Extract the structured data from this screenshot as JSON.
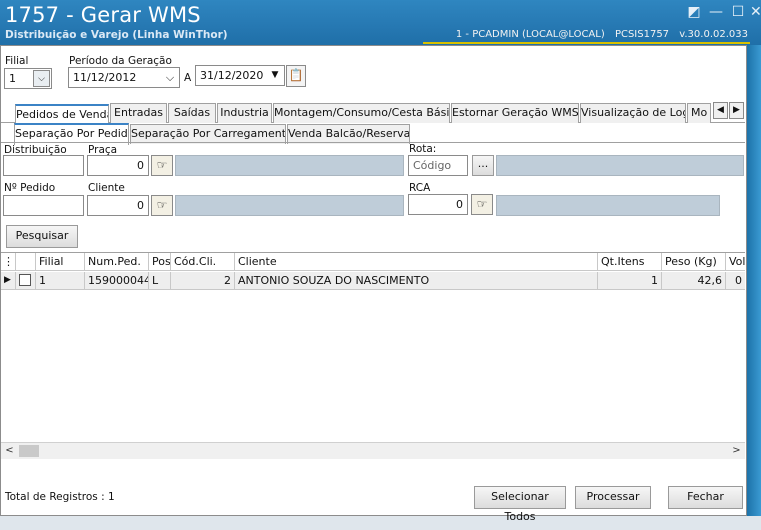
{
  "window": {
    "title": "1757 - Gerar WMS",
    "subtitle": "Distribuição e Varejo (Linha WinThor)",
    "status": [
      "1 - PCADMIN (LOCAL@LOCAL)",
      "PCSIS1757",
      "v.30.0.02.033"
    ],
    "controls": {
      "restore": "◩",
      "minimize": "—",
      "maximize": "☐",
      "close": "✕"
    }
  },
  "filters": {
    "filial_label": "Filial",
    "filial_value": "1",
    "periodo_label": "Período da Geração",
    "date_from": "11/12/2012",
    "to_label": "A",
    "date_to": "31/12/2020"
  },
  "tabs": [
    "Pedidos de Venda",
    "Entradas",
    "Saídas",
    "Industria",
    "Montagem/Consumo/Cesta Básica",
    "Estornar Geração WMS",
    "Visualização de Log",
    "Mo"
  ],
  "subtabs": [
    "Separação Por Pedido",
    "Separação Por Carregamento",
    "Venda Balcão/Reserva"
  ],
  "form": {
    "distribuicao_label": "Distribuição",
    "praca_label": "Praça",
    "praca_value": "0",
    "rota_label": "Rota:",
    "rota_placeholder": "Código",
    "rota_button": "...",
    "pedido_label": "Nº Pedido",
    "cliente_label": "Cliente",
    "cliente_value": "0",
    "rca_label": "RCA",
    "rca_value": "0",
    "pesquisar": "Pesquisar"
  },
  "grid": {
    "columns": [
      "Filial",
      "Num.Ped.",
      "Pos",
      "Cód.Cli.",
      "Cliente",
      "Qt.Itens",
      "Peso (Kg)",
      "Volu"
    ],
    "rows": [
      {
        "filial": "1",
        "num_ped": "159000044",
        "pos": "L",
        "cod_cli": "2",
        "cliente": "ANTONIO SOUZA DO NASCIMENTO",
        "qt_itens": "1",
        "peso": "42,6",
        "volume": "0"
      }
    ]
  },
  "footer": {
    "total_registros": "Total de Registros : 1",
    "selecionar_todos": "Selecionar Todos",
    "processar": "Processar",
    "fechar": "Fechar"
  }
}
